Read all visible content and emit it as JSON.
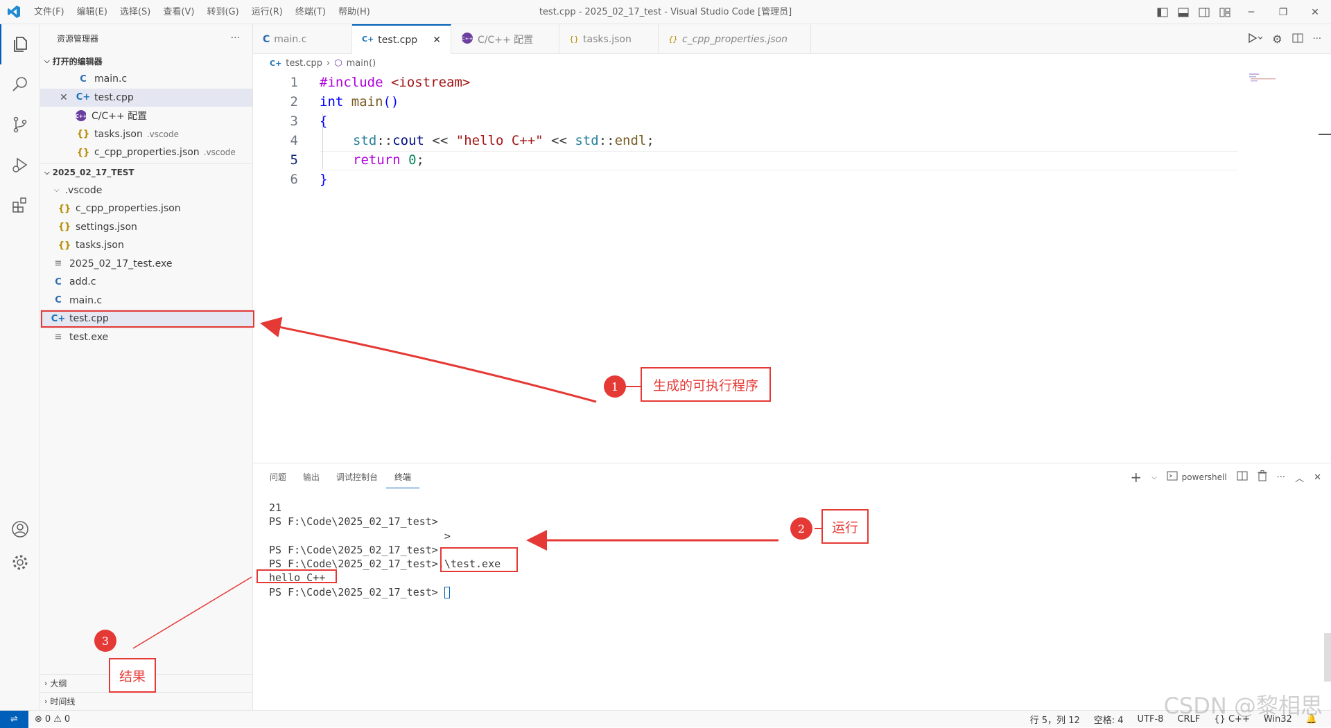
{
  "titlebar": {
    "menu": [
      "文件(F)",
      "编辑(E)",
      "选择(S)",
      "查看(V)",
      "转到(G)",
      "运行(R)",
      "终端(T)",
      "帮助(H)"
    ],
    "title": "test.cpp - 2025_02_17_test - Visual Studio Code [管理员]"
  },
  "sidebar": {
    "title": "资源管理器",
    "more": "···",
    "open_editors": {
      "header": "打开的编辑器",
      "items": [
        {
          "icon": "C",
          "label": "main.c",
          "desc": ""
        },
        {
          "icon": "C+",
          "label": "test.cpp",
          "desc": ""
        },
        {
          "icon": "settings",
          "label": "C/C++ 配置",
          "desc": ""
        },
        {
          "icon": "{}",
          "label": "tasks.json",
          "desc": ".vscode"
        },
        {
          "icon": "{}",
          "label": "c_cpp_properties.json",
          "desc": ".vscode"
        }
      ]
    },
    "folder": {
      "header": "2025_02_17_TEST",
      "items": [
        {
          "icon": "folder",
          "label": ".vscode"
        },
        {
          "icon": "{}",
          "label": "c_cpp_properties.json"
        },
        {
          "icon": "{}",
          "label": "settings.json"
        },
        {
          "icon": "{}",
          "label": "tasks.json"
        },
        {
          "icon": "exe",
          "label": "2025_02_17_test.exe"
        },
        {
          "icon": "C",
          "label": "add.c"
        },
        {
          "icon": "C",
          "label": "main.c"
        },
        {
          "icon": "C+",
          "label": "test.cpp"
        },
        {
          "icon": "exe",
          "label": "test.exe"
        }
      ]
    },
    "outline": "大纲",
    "timeline": "时间线"
  },
  "tabs": [
    {
      "label": "main.c",
      "active": false
    },
    {
      "label": "test.cpp",
      "active": true
    },
    {
      "label": "C/C++ 配置",
      "active": false
    },
    {
      "label": "tasks.json",
      "active": false
    },
    {
      "label": "c_cpp_properties.json",
      "active": false
    }
  ],
  "breadcrumb": {
    "file": "test.cpp",
    "symbol": "main()"
  },
  "code": {
    "line_numbers": [
      "1",
      "2",
      "3",
      "4",
      "5",
      "6"
    ],
    "l1a": "#include",
    "l1b": "<iostream>",
    "l2a": "int",
    "l2b": "main",
    "l2c": "()",
    "l3": "{",
    "l4a": "std",
    "l4b": "::",
    "l4c": "cout",
    "l4d": " << ",
    "l4e": "\"hello C++\"",
    "l4f": " << ",
    "l4g": "std",
    "l4h": "::",
    "l4i": "endl",
    "l4j": ";",
    "l5a": "return",
    "l5b": "0",
    "l5c": ";",
    "l6": "}"
  },
  "panel": {
    "tabs": [
      "问题",
      "输出",
      "调试控制台",
      "终端"
    ],
    "shell": "powershell",
    "terminal": {
      "l1": "21",
      "l2": "PS F:\\Code\\2025_02_17_test>",
      "l3": "                            >",
      "l4": "PS F:\\Code\\2025_02_17_test>",
      "l5a": "PS F:\\Code\\2025_02_17_test>",
      "l5b": ".\\test.exe",
      "l6": "hello C++",
      "l7": "PS F:\\Code\\2025_02_17_test>"
    }
  },
  "status": {
    "errors": "0",
    "warnings": "0",
    "position": "行 5，列 12",
    "spaces": "空格: 4",
    "encoding": "UTF-8",
    "eol": "CRLF",
    "language": "C++",
    "platform": "Win32"
  },
  "annotations": {
    "a1_num": "1",
    "a1_text": "生成的可执行程序",
    "a2_num": "2",
    "a2_text": "运行",
    "a3_num": "3",
    "a3_text": "结果",
    "watermark": "CSDN @黎相思"
  },
  "colors": {
    "accent": "#005fb8",
    "annotation": "#e53935"
  }
}
